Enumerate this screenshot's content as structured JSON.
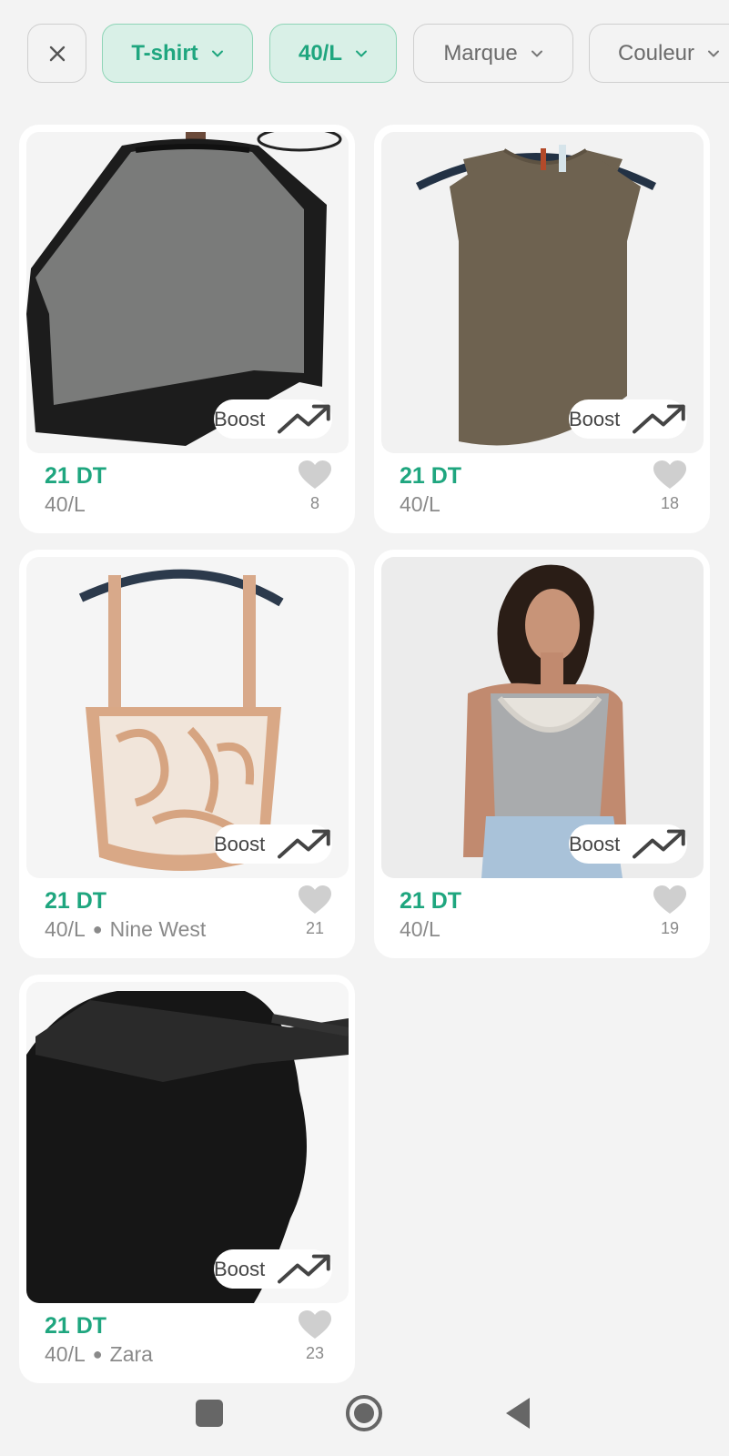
{
  "filters": {
    "close_icon": "close-icon",
    "chips": [
      {
        "label": "T-shirt",
        "active": true
      },
      {
        "label": "40/L",
        "active": true
      },
      {
        "label": "Marque",
        "active": false
      },
      {
        "label": "Couleur",
        "active": false
      }
    ]
  },
  "boost_label": "Boost",
  "colors": {
    "accent": "#1fa67f",
    "chip_active_bg": "#d9f0e7",
    "background": "#f3f3f3",
    "muted_text": "#8a8a8a",
    "heart": "#cfcfcf"
  },
  "products": [
    {
      "price": "21 DT",
      "meta": "40/L",
      "brand": "",
      "likes": "8",
      "image": "grey-black-poncho-top"
    },
    {
      "price": "21 DT",
      "meta": "40/L",
      "brand": "",
      "likes": "18",
      "image": "brown-knit-tank"
    },
    {
      "price": "21 DT",
      "meta": "40/L",
      "brand": "Nine West",
      "likes": "21",
      "image": "snakeprint-cami"
    },
    {
      "price": "21 DT",
      "meta": "40/L",
      "brand": "",
      "likes": "19",
      "image": "model-grey-ruffle-tank"
    },
    {
      "price": "21 DT",
      "meta": "40/L",
      "brand": "Zara",
      "likes": "23",
      "image": "black-halter-top"
    }
  ],
  "system_nav": {
    "recents": "recents-icon",
    "home": "home-icon",
    "back": "back-icon"
  }
}
